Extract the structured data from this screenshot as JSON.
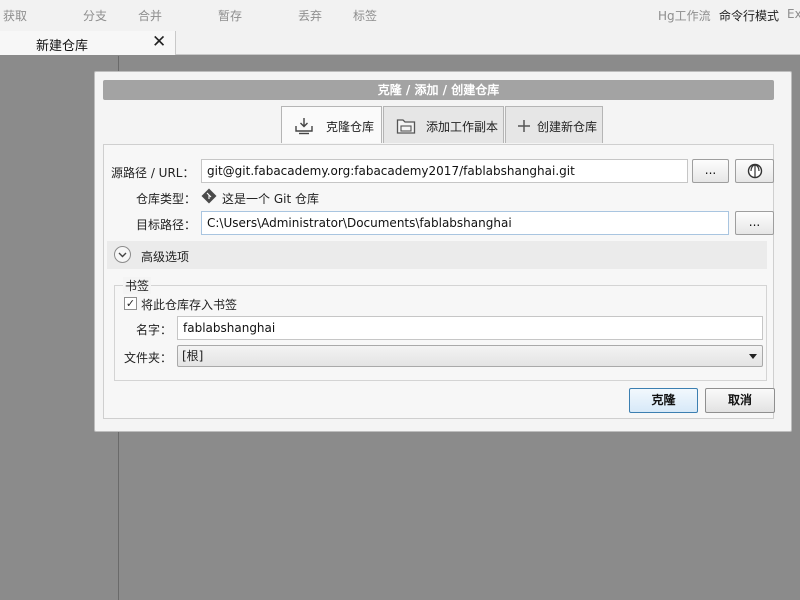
{
  "toolbar": {
    "items": [
      "获取",
      "分支",
      "合并",
      "暂存",
      "丢弃",
      "标签"
    ],
    "right_items": [
      "Hg工作流",
      "命令行模式",
      "Ex"
    ]
  },
  "tabs": {
    "label": "新建仓库",
    "close_glyph": "✕"
  },
  "dialog": {
    "title": "克隆 / 添加 / 创建仓库",
    "mode_tabs": [
      "克隆仓库",
      "添加工作副本",
      "创建新仓库"
    ],
    "source_label": "源路径 / URL：",
    "source_value": "git@git.fabacademy.org:fabacademy2017/fablabshanghai.git",
    "browse_label": "...",
    "repo_type_label": "仓库类型：",
    "repo_type_value": "这是一个 Git 仓库",
    "dest_label": "目标路径：",
    "dest_value": "C:\\Users\\Administrator\\Documents\\fablabshanghai",
    "advanced_label": "高级选项",
    "bookmark": {
      "group_title": "书签",
      "checkbox_label": "将此仓库存入书签",
      "checked": true,
      "name_label": "名字：",
      "name_value": "fablabshanghai",
      "folder_label": "文件夹：",
      "folder_value": "[根]"
    },
    "clone_button": "克隆",
    "cancel_button": "取消"
  },
  "colors": {
    "title_bar": "#a3a3a3",
    "workspace": "#8b8b8b",
    "primary_border": "#3c7fb1",
    "git_diamond": "#4a4a4a"
  }
}
